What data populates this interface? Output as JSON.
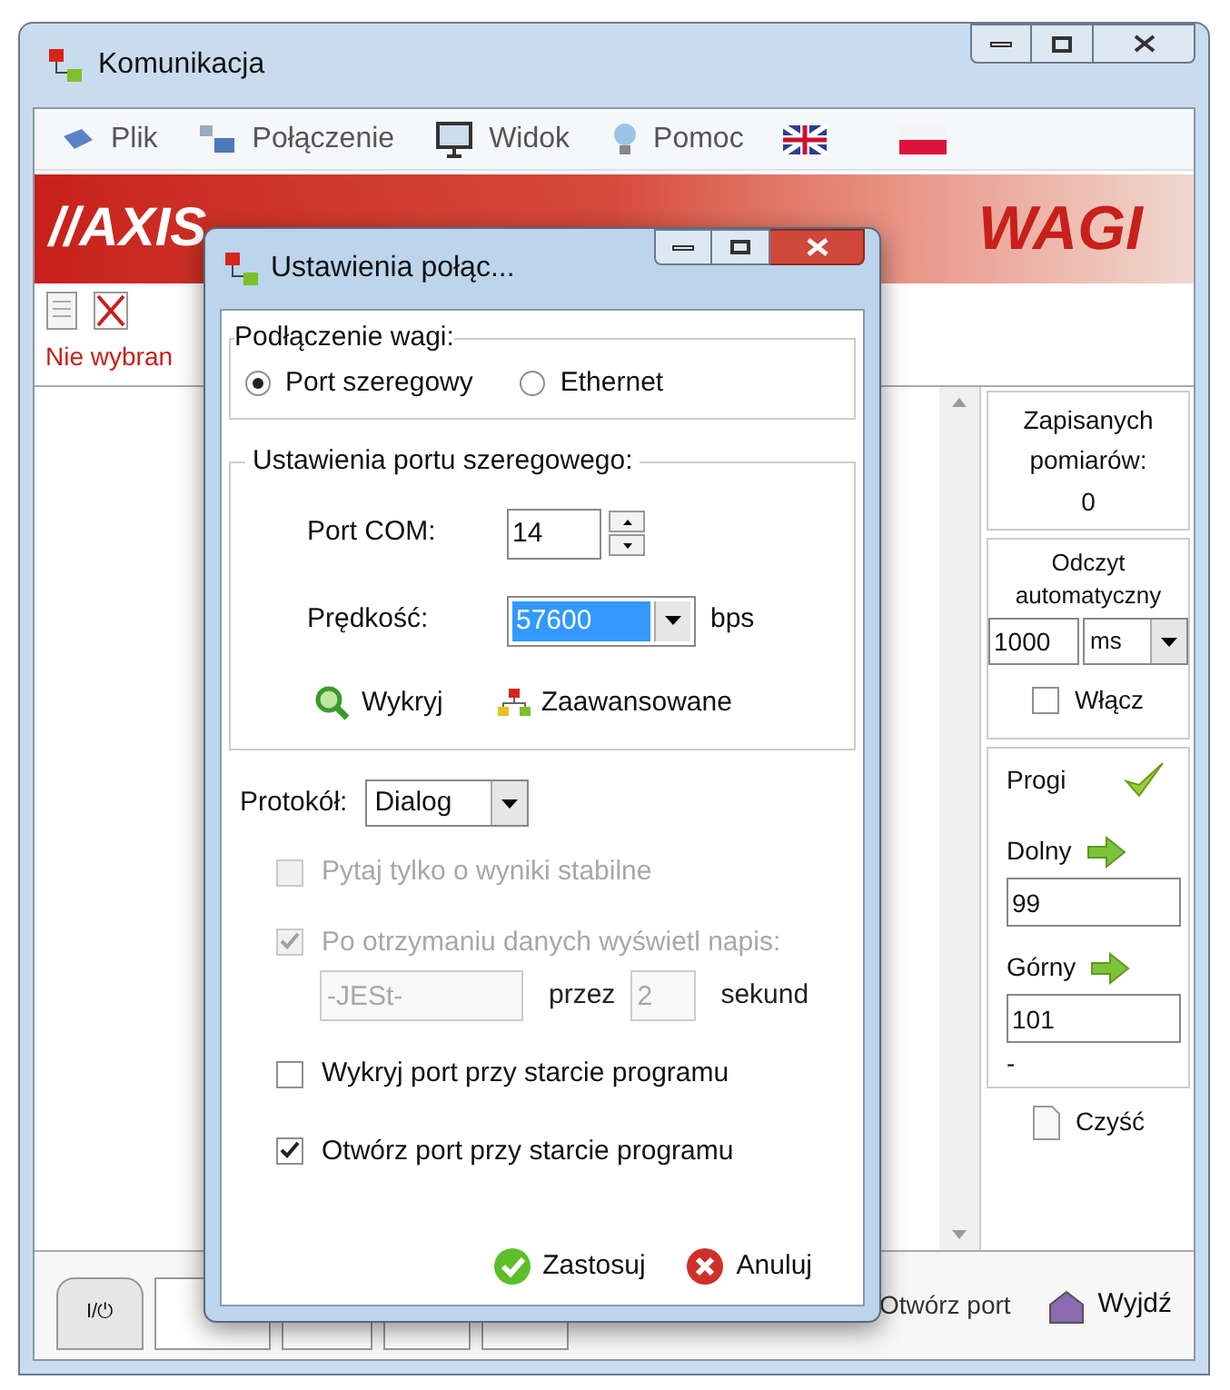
{
  "window": {
    "title": "Komunikacja"
  },
  "menu": [
    {
      "label": "Plik"
    },
    {
      "label": "Połączenie"
    },
    {
      "label": "Widok"
    },
    {
      "label": "Pomoc"
    }
  ],
  "banner": {
    "logo": "//AXIS",
    "brand": "WAGI"
  },
  "toolbar": {
    "status": "Nie wybran"
  },
  "side_panel": {
    "saved_label": "Zapisanych pomiarów:",
    "saved_count": "0",
    "auto_title": "Odczyt automatyczny",
    "interval": "1000",
    "unit": "ms",
    "enable": {
      "label": "Włącz",
      "checked": false
    },
    "thresholds_title": "Progi",
    "lower_label": "Dolny",
    "lower_value": "99",
    "upper_label": "Górny",
    "upper_value": "101",
    "note": "-",
    "clear": "Czyść"
  },
  "bottom_bar": {
    "power_label": "I/⏻",
    "open_port": "Otwórz port",
    "exit": "Wyjdź"
  },
  "dialog": {
    "title": "Ustawienia połąc...",
    "connection": {
      "legend": "Podłączenie wagi:",
      "options": [
        {
          "label": "Port szeregowy",
          "selected": true
        },
        {
          "label": "Ethernet",
          "selected": false
        }
      ]
    },
    "serial": {
      "legend": "Ustawienia portu szeregowego:",
      "port_label": "Port COM:",
      "port_value": "14",
      "speed_label": "Prędkość:",
      "speed_value": "57600",
      "speed_unit": "bps",
      "detect": "Wykryj",
      "advanced": "Zaawansowane"
    },
    "protocol": {
      "label": "Protokół:",
      "value": "Dialog"
    },
    "protocol_options": [
      {
        "label": "Pytaj tylko o wyniki stabilne",
        "checked": false,
        "disabled": true
      },
      {
        "label": "Po otrzymaniu danych wyświetl napis:",
        "checked": true,
        "disabled": true
      }
    ],
    "display": {
      "text": "-JESt-",
      "for_label": "przez",
      "seconds": "2",
      "seconds_label": "sekund",
      "disabled": true
    },
    "startup_options": [
      {
        "label": "Wykryj port przy starcie programu",
        "checked": false,
        "disabled": false
      },
      {
        "label": "Otwórz port przy starcie programu",
        "checked": true,
        "disabled": false
      }
    ],
    "apply": "Zastosuj",
    "cancel": "Anuluj"
  }
}
